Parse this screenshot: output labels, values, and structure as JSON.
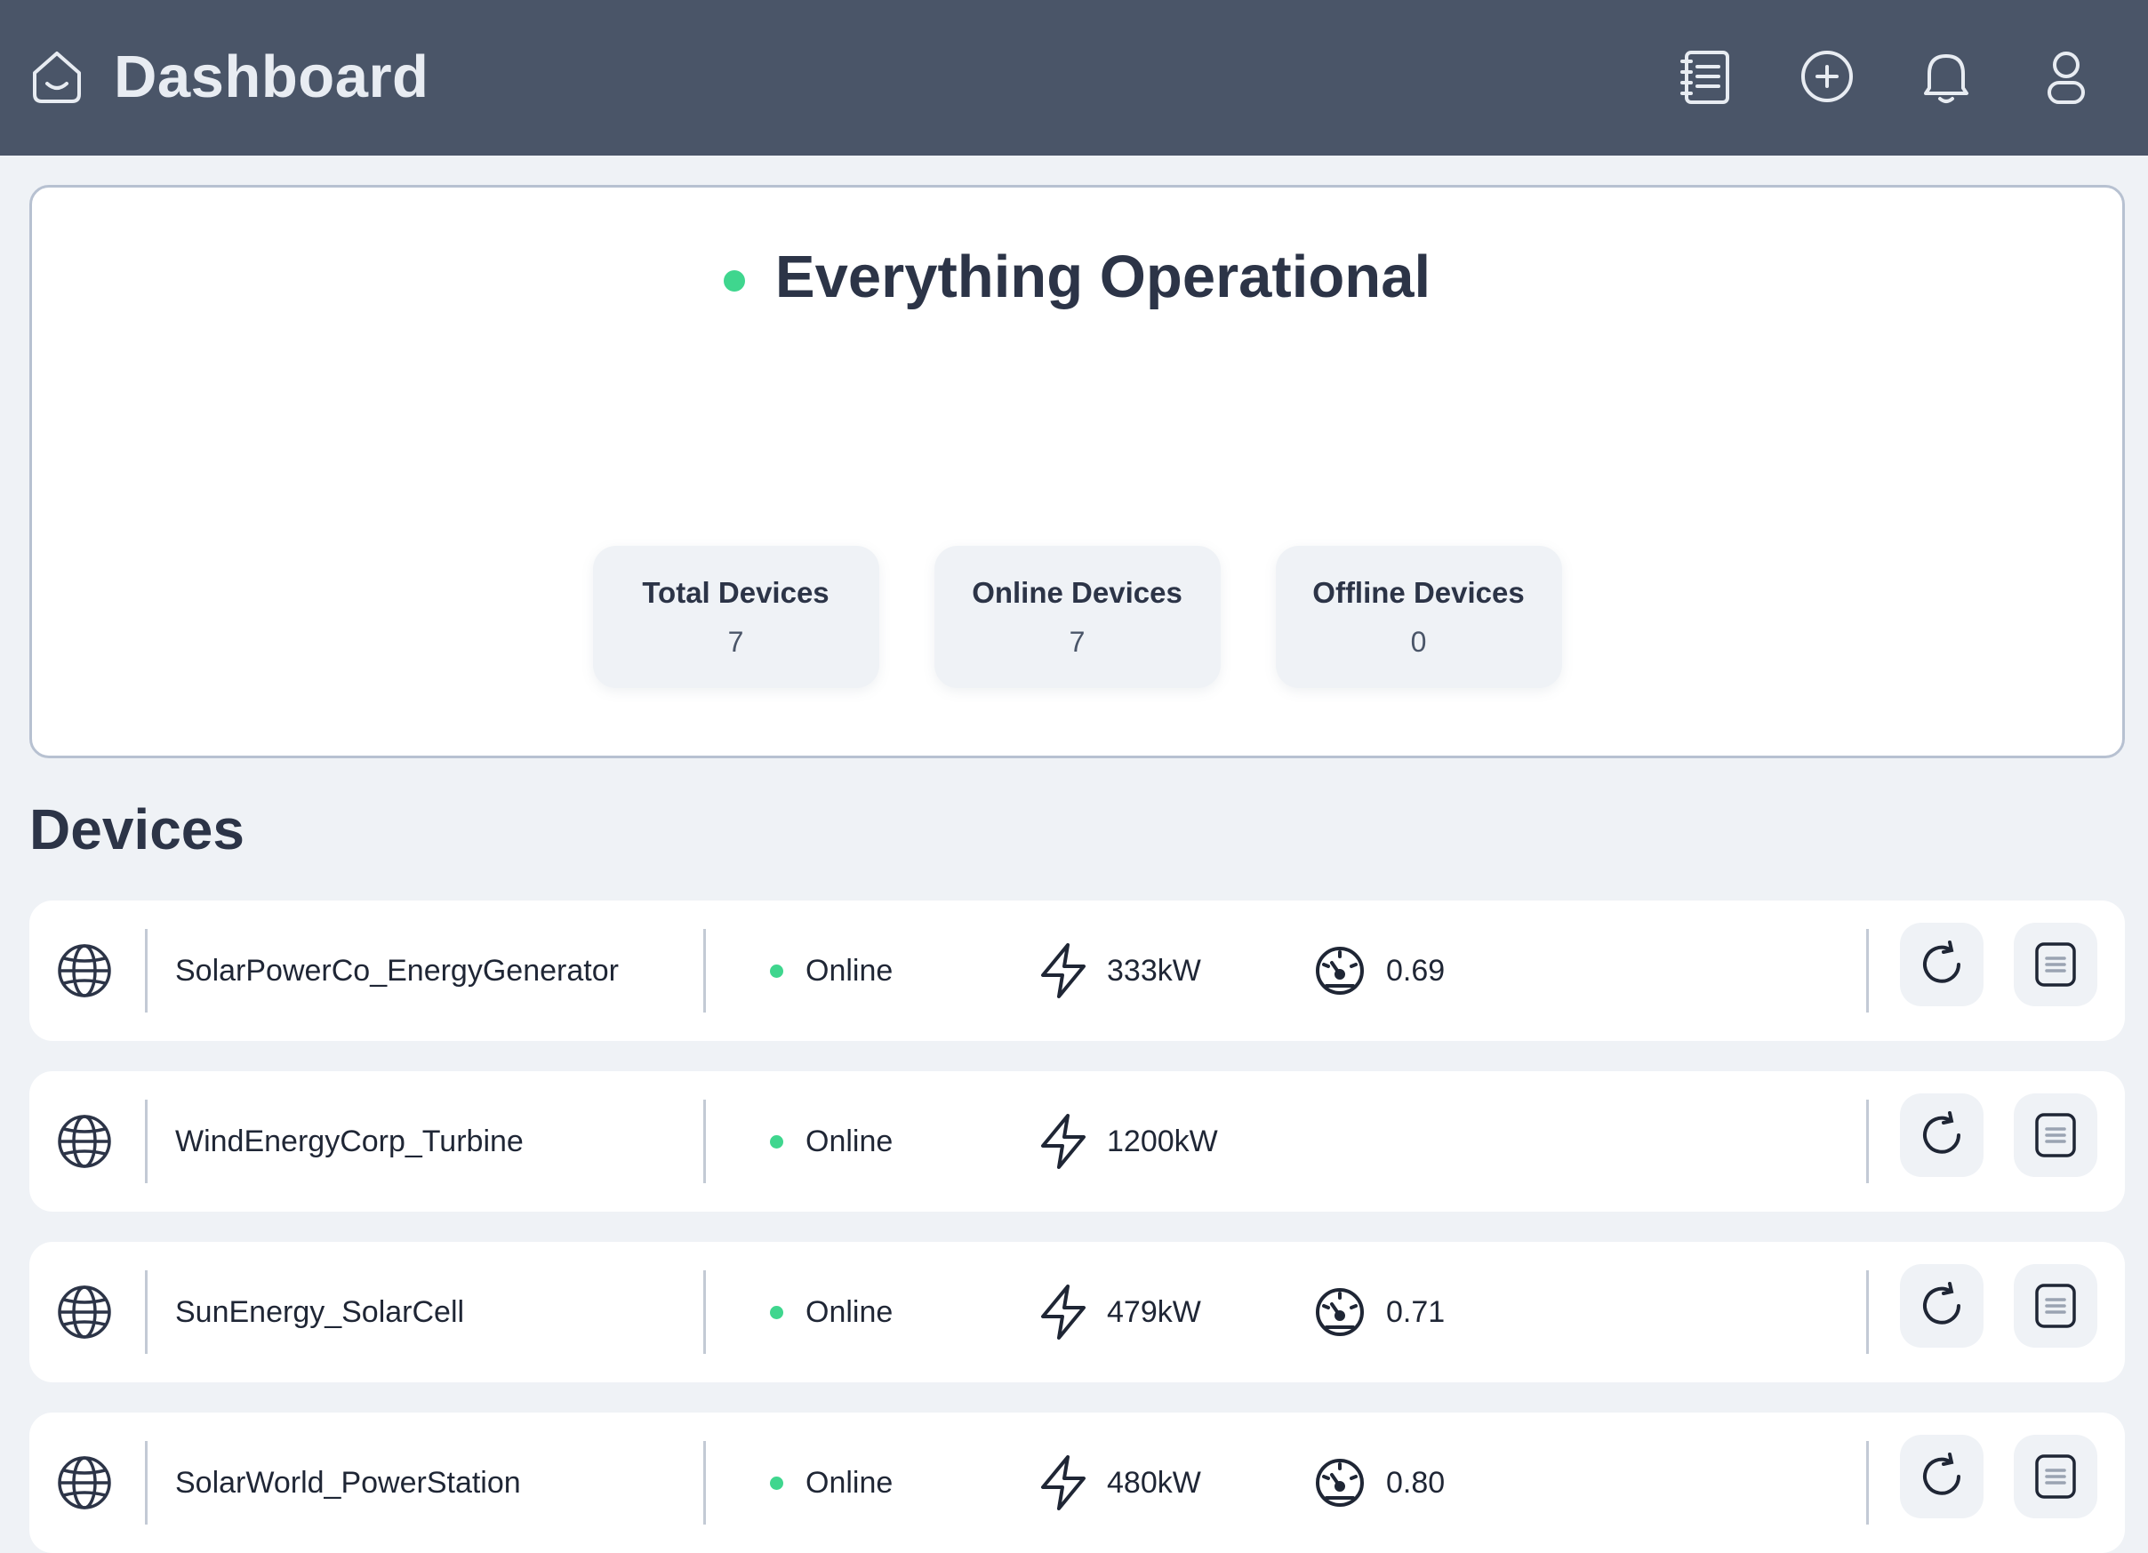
{
  "header": {
    "title": "Dashboard",
    "icons": [
      "home-icon",
      "notes-icon",
      "add-circle-icon",
      "bell-icon",
      "user-icon"
    ]
  },
  "status": {
    "text": "Everything Operational",
    "color": "#3fd68e",
    "stats": [
      {
        "label": "Total Devices",
        "value": "7"
      },
      {
        "label": "Online Devices",
        "value": "7"
      },
      {
        "label": "Offline Devices",
        "value": "0"
      }
    ]
  },
  "devices": {
    "title": "Devices",
    "items": [
      {
        "name": "SolarPowerCo_EnergyGenerator",
        "status": "Online",
        "power": "333kW",
        "power_factor": "0.69"
      },
      {
        "name": "WindEnergyCorp_Turbine",
        "status": "Online",
        "power": "1200kW",
        "power_factor": ""
      },
      {
        "name": "SunEnergy_SolarCell",
        "status": "Online",
        "power": "479kW",
        "power_factor": "0.71"
      },
      {
        "name": "SolarWorld_PowerStation",
        "status": "Online",
        "power": "480kW",
        "power_factor": "0.80"
      }
    ]
  },
  "colors": {
    "header_bg": "#4a5568",
    "page_bg": "#eff2f6",
    "online": "#3fd68e",
    "text_dark": "#2c3447"
  }
}
